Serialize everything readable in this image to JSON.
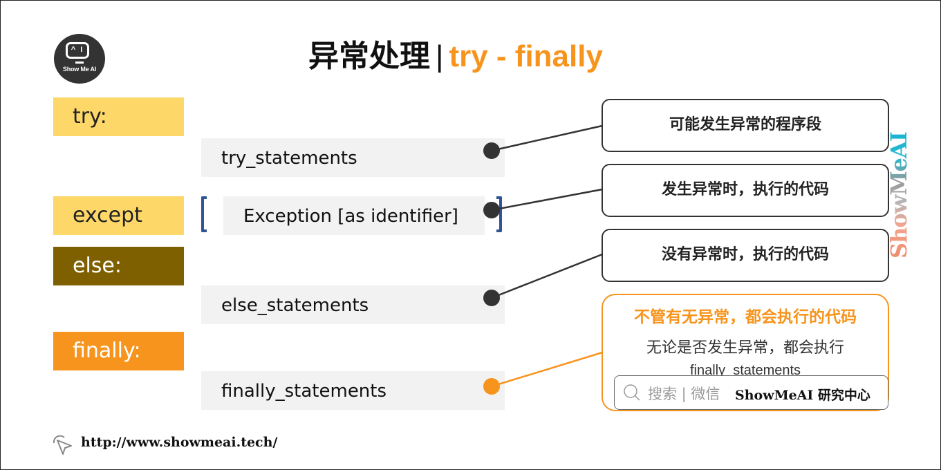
{
  "logo": {
    "screen_text": "^ I",
    "brand_text": "Show Me AI"
  },
  "title": {
    "cn": "异常处理",
    "separator": "|",
    "en": "try - finally"
  },
  "keywords": {
    "try": "try:",
    "except": "except",
    "else": "else:",
    "finally": "finally:"
  },
  "statements": {
    "try": "try_statements",
    "except": "Exception [as identifier]",
    "else": "else_statements",
    "finally": "finally_statements"
  },
  "callouts": {
    "try": "可能发生异常的程序段",
    "except": "发生异常时，执行的代码",
    "else": "没有异常时，执行的代码",
    "finally": {
      "heading": "不管有无异常，都会执行的代码",
      "body": "无论是否发生异常，都会执行",
      "code": "finally_statements"
    }
  },
  "watermark": {
    "search_text": "搜索 | 微信",
    "brand": "ShowMeAI 研究中心",
    "vertical": "ShowMeAI"
  },
  "colors": {
    "accent_orange": "#f7941d",
    "yellow": "#fdd767",
    "brown": "#7f6000",
    "bracket_blue": "#2f5597"
  },
  "footer": {
    "url": "http://www.showmeai.tech/"
  }
}
